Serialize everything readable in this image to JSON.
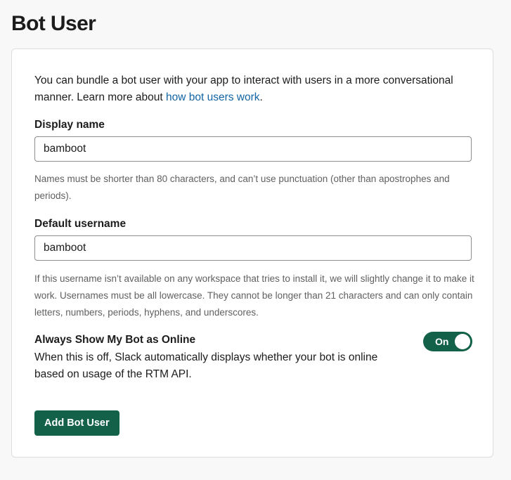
{
  "page": {
    "title": "Bot User"
  },
  "intro": {
    "text": "You can bundle a bot user with your app to interact with users in a more conversational manner. Learn more about ",
    "link_text": "how bot users work",
    "suffix": "."
  },
  "display_name": {
    "label": "Display name",
    "value": "bamboot",
    "hint": "Names must be shorter than 80 characters, and can’t use punctuation (other than apostrophes and periods)."
  },
  "default_username": {
    "label": "Default username",
    "value": "bamboot",
    "hint": "If this username isn’t available on any workspace that tries to install it, we will slightly change it to make it work. Usernames must be all lowercase. They cannot be longer than 21 characters and can only contain letters, numbers, periods, hyphens, and underscores."
  },
  "online_setting": {
    "title": "Always Show My Bot as Online",
    "description": "When this is off, Slack automatically displays whether your bot is online based on usage of the RTM API.",
    "toggle_label": "On",
    "enabled": true
  },
  "actions": {
    "add_label": "Add Bot User"
  },
  "colors": {
    "accent": "#126148",
    "link": "#1264a3",
    "hint_text": "#616061"
  }
}
